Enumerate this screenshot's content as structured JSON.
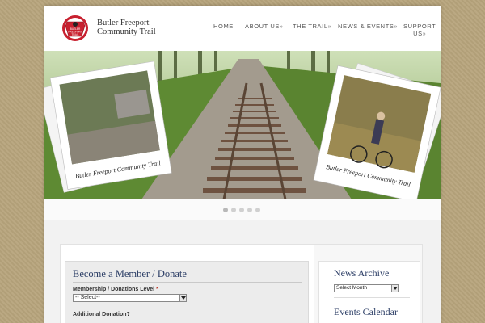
{
  "site": {
    "name_line1": "Butler Freeport",
    "name_line2": "Community Trail",
    "badge_text_line1": "BUTLER",
    "badge_text_line2": "FREEPORT",
    "badge_text_line3": "TRAIL",
    "logo_icon": "keystone-badge-icon"
  },
  "nav": {
    "items": [
      {
        "label": "HOME",
        "caret": ""
      },
      {
        "label": "ABOUT US",
        "caret": "»"
      },
      {
        "label": "THE TRAIL",
        "caret": "»"
      },
      {
        "label": "NEWS & EVENTS",
        "caret": "»"
      },
      {
        "label": "SUPPORT",
        "label2": "US",
        "caret": "»"
      }
    ]
  },
  "slider": {
    "photo_caption_left": "Butler Freeport Community Trail",
    "photo_caption_right": "Butler Freeport Community Trail",
    "dot_count": 5,
    "active_dot": 1
  },
  "form": {
    "title": "Become a Member / Donate",
    "membership_label": "Membership / Donations Level",
    "required_mark": "*",
    "membership_value": "-- Select--",
    "additional_label": "Additional Donation?"
  },
  "sidebar": {
    "news_title": "News Archive",
    "news_select": "Select Month",
    "events_title": "Events Calendar"
  },
  "colors": {
    "background": "#b7a47c",
    "title_blue": "#2c3e66",
    "logo_red": "#c8202f"
  }
}
